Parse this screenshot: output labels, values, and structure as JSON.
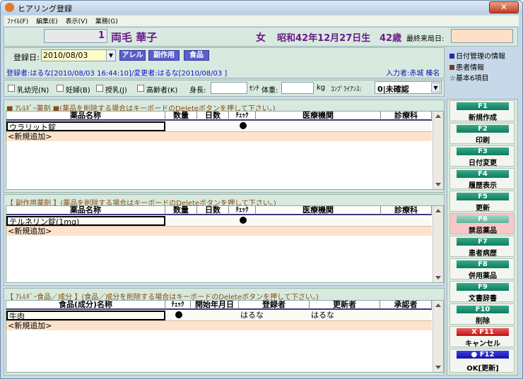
{
  "window": {
    "title": "ヒアリング登録"
  },
  "menu": [
    "ﾌｧｲﾙ(F)",
    "編集(E)",
    "表示(V)",
    "業務(G)"
  ],
  "patient": {
    "id": "1",
    "name": "両毛 華子",
    "sex": "女",
    "birth": "昭和42年12月27日生",
    "age": "42歳",
    "last_visit_label": "最終来局日:",
    "last_visit_value": ""
  },
  "reg": {
    "date_label": "登録日:",
    "date_value": "2010/08/03",
    "buttons": [
      "アレル",
      "副作用",
      "食品"
    ],
    "info": "登録者:はるな[2010/08/03 16:44:10]/変更者:はるな[2010/08/03 ]",
    "input_person": "入力者:赤城 榛名"
  },
  "sidebar_info": [
    {
      "label": "日付管理の情報",
      "color": "#1d2d9a"
    },
    {
      "label": "患者情報",
      "color": "#7a3a1a"
    },
    {
      "label": "☆基本6項目",
      "color": ""
    }
  ],
  "flags": {
    "items": [
      "乳幼児(N)",
      "妊婦(B)",
      "授乳(J)",
      "高齢者(K)"
    ],
    "height_label": "身長:",
    "height_unit": "ｾﾝﾁ",
    "weight_label": "体重:",
    "weight_unit": "kg",
    "compliance_label": "ｺﾝﾌﾟﾗｲｱﾝｽ:",
    "compliance_value": "0|未確認"
  },
  "allergy_drug": {
    "caption_head": "■ ｱﾚﾙｷﾞｰ薬剤 ■",
    "caption_note": "(薬品を削除する場合はキーボードのDeleteボタンを押して下さい。)",
    "columns": [
      "薬品名称",
      "数量",
      "日数",
      "ﾁｪｯｸ",
      "医療機関",
      "診療科"
    ],
    "rows": [
      {
        "name": "ウラリット錠",
        "check": "●"
      }
    ],
    "new_row": "<新規追加>"
  },
  "side_effect_drug": {
    "caption_head": "【 副作用薬剤 】",
    "caption_note": "(薬品を削除する場合はキーボードのDeleteボタンを押して下さい。)",
    "columns": [
      "薬品名称",
      "数量",
      "日数",
      "ﾁｪｯｸ",
      "医療機関",
      "診療科"
    ],
    "rows": [
      {
        "name": "テルネリン錠(1mg)",
        "check": "●"
      }
    ],
    "new_row": "<新規追加>"
  },
  "allergy_food": {
    "caption_head": "【 ｱﾚﾙｷﾞｰ食品／成分 】",
    "caption_note": "(食品／成分を削除する場合はキーボードのDeleteボタンを押して下さい。)",
    "columns": [
      "食品(成分)名称",
      "ﾁｪｯｸ",
      "開始年月日",
      "登録者",
      "更新者",
      "承認者"
    ],
    "rows": [
      {
        "name": "牛肉",
        "check": "●",
        "reg": "はるな",
        "upd": "はるな"
      }
    ],
    "new_row": "<新規追加>"
  },
  "fkeys": [
    {
      "key": "F1",
      "label": "新規作成"
    },
    {
      "key": "F2",
      "label": "印刷"
    },
    {
      "key": "F3",
      "label": "日付変更"
    },
    {
      "key": "F4",
      "label": "履歴表示"
    },
    {
      "key": "F5",
      "label": "更新"
    },
    {
      "key": "F6",
      "label": "禁忌薬品"
    },
    {
      "key": "F7",
      "label": "患者病歴"
    },
    {
      "key": "F8",
      "label": "併用薬品"
    },
    {
      "key": "F9",
      "label": "文書辞書"
    },
    {
      "key": "F10",
      "label": "削除"
    },
    {
      "key": "X  F11",
      "label": "キャンセル"
    },
    {
      "key": "●  F12",
      "label": "OK[更新]"
    }
  ],
  "colors": {
    "purple": "#6a1a8a",
    "brown": "#8a4a10",
    "teal": "#0d7d60",
    "red": "#d42020",
    "blue": "#1010c0"
  }
}
